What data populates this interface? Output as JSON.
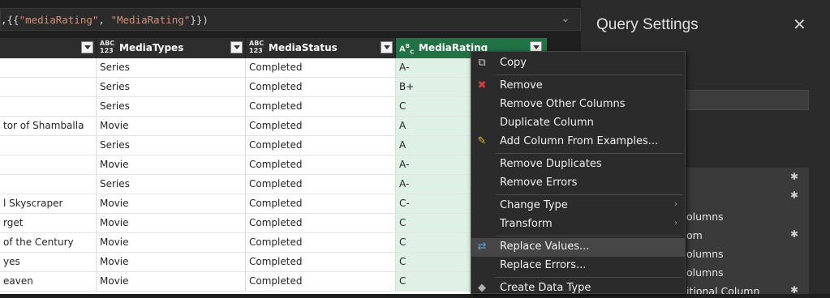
{
  "formula": {
    "pre": ",{{",
    "s1": "\"mediaRating\"",
    "mid": ", ",
    "s2": "\"MediaRating\"",
    "post": "}})"
  },
  "columns": [
    {
      "type_top": "",
      "type_bottom": "",
      "label": ""
    },
    {
      "type_top": "ABC",
      "type_bottom": "123",
      "label": "MediaTypes"
    },
    {
      "type_top": "ABC",
      "type_bottom": "123",
      "label": "MediaStatus"
    },
    {
      "type_top": "A",
      "type_bottom": "",
      "label": "MediaRating"
    }
  ],
  "rows": [
    [
      "",
      "Series",
      "Completed",
      "A-"
    ],
    [
      "",
      "Series",
      "Completed",
      "B+"
    ],
    [
      "",
      "Series",
      "Completed",
      "C"
    ],
    [
      "tor of Shamballa",
      "Movie",
      "Completed",
      "A"
    ],
    [
      "",
      "Series",
      "Completed",
      "A"
    ],
    [
      "",
      "Movie",
      "Completed",
      "A-"
    ],
    [
      "",
      "Series",
      "Completed",
      "A-"
    ],
    [
      "l Skyscraper",
      "Movie",
      "Completed",
      "C-"
    ],
    [
      "rget",
      "Movie",
      "Completed",
      "C"
    ],
    [
      "of the Century",
      "Movie",
      "Completed",
      "C"
    ],
    [
      "yes",
      "Movie",
      "Completed",
      "C"
    ],
    [
      "eaven",
      "Movie",
      "Completed",
      "C"
    ]
  ],
  "panel": {
    "title": "Query Settings",
    "close": "✕",
    "steps": [
      {
        "label": "",
        "gear": true
      },
      {
        "label": "",
        "gear": true
      },
      {
        "label": "olumns",
        "gear": false
      },
      {
        "label": "om",
        "gear": true
      },
      {
        "label": "olumns",
        "gear": false
      },
      {
        "label": "olumns",
        "gear": false
      },
      {
        "label": "itional Column",
        "gear": true
      }
    ]
  },
  "menu": {
    "items": [
      {
        "label": "Copy",
        "icon": "copy-icon",
        "color": "#c8c8c8"
      },
      {
        "label": "Remove",
        "icon": "remove-icon",
        "color": "#d04040"
      },
      {
        "label": "Remove Other Columns"
      },
      {
        "label": "Duplicate Column"
      },
      {
        "label": "Add Column From Examples...",
        "icon": "examples-icon",
        "color": "#e0b040"
      },
      {
        "label": "Remove Duplicates"
      },
      {
        "label": "Remove Errors"
      },
      {
        "label": "Change Type",
        "submenu": true
      },
      {
        "label": "Transform",
        "submenu": true
      },
      {
        "label": "Replace Values...",
        "icon": "replace-icon",
        "color": "#5aa0e0",
        "highlighted": true
      },
      {
        "label": "Replace Errors..."
      },
      {
        "label": "Create Data Type",
        "icon": "data-type-icon",
        "color": "#b0b0b0"
      }
    ]
  },
  "colors": {
    "selected_header": "#217346",
    "rating_cell": "#dff0e5",
    "string_literal": "#ce9178"
  }
}
